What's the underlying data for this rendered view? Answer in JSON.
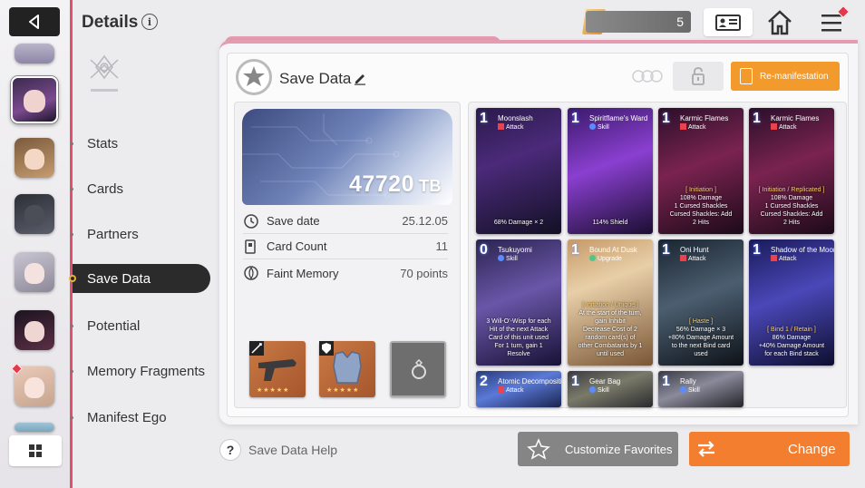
{
  "header": {
    "title": "Details",
    "currency_amount": "5"
  },
  "nav": {
    "items": [
      {
        "label": "Stats",
        "active": false
      },
      {
        "label": "Cards",
        "active": false
      },
      {
        "label": "Partners",
        "active": false
      },
      {
        "label": "Save Data",
        "active": true
      },
      {
        "label": "Potential",
        "active": false
      },
      {
        "label": "Memory Fragments",
        "active": false
      },
      {
        "label": "Manifest Ego",
        "active": false
      }
    ]
  },
  "save": {
    "title": "Save Data",
    "tb_value": "47720",
    "tb_unit": "TB",
    "remanifest_label": "Re-manifestation",
    "stats": [
      {
        "label": "Save date",
        "value": "25.12.05"
      },
      {
        "label": "Card Count",
        "value": "11"
      },
      {
        "label": "Faint Memory",
        "value": "70 points"
      }
    ]
  },
  "cards": [
    {
      "cost": "1",
      "name": "Moonslash",
      "type": "Attack",
      "desc": "68% Damage × 2",
      "tag": ""
    },
    {
      "cost": "1",
      "name": "Spiritflame's Ward",
      "type": "Skill",
      "desc": "114% Shield",
      "tag": ""
    },
    {
      "cost": "1",
      "name": "Karmic Flames",
      "type": "Attack",
      "desc": "108% Damage\n1 Cursed Shackles\nCursed Shackles: Add\n2 Hits",
      "tag": "[ Initiation ]"
    },
    {
      "cost": "1",
      "name": "Karmic Flames",
      "type": "Attack",
      "desc": "108% Damage\n1 Cursed Shackles\nCursed Shackles: Add\n2 Hits",
      "tag": "[ Initiation / Replicated ]"
    },
    {
      "cost": "0",
      "name": "Tsukuyomi",
      "type": "Skill",
      "desc": "3 Will-O'-Wisp for each\nHit of the next Attack\nCard of this unit used\nFor 1 turn, gain 1\nResolve",
      "tag": ""
    },
    {
      "cost": "1",
      "name": "Bound At Dusk",
      "type": "Upgrade",
      "desc": "At the start of the turn,\ngain Inhibit\nDecrease Cost of 2\nrandom card(s) of\nother Combatants by 1\nuntil used",
      "tag": "[ Initiation / Unique ]"
    },
    {
      "cost": "1",
      "name": "Oni Hunt",
      "type": "Attack",
      "desc": "56% Damage × 3\n+80% Damage Amount\nto the next Bind card\nused",
      "tag": "[ Haste ]"
    },
    {
      "cost": "1",
      "name": "Shadow of the Moon",
      "type": "Attack",
      "desc": "86% Damage\n+40% Damage Amount\nfor each Bind stack",
      "tag": "[ Bind 1 / Retain ]"
    },
    {
      "cost": "2",
      "name": "Atomic Decomposition",
      "type": "Attack",
      "desc": "",
      "tag": ""
    },
    {
      "cost": "1",
      "name": "Gear Bag",
      "type": "Skill",
      "desc": "",
      "tag": ""
    },
    {
      "cost": "1",
      "name": "Rally",
      "type": "Skill",
      "desc": "",
      "tag": ""
    }
  ],
  "footer": {
    "help_label": "Save Data Help",
    "favorites_label": "Customize Favorites",
    "change_label": "Change"
  },
  "colors": {
    "accent_pink": "#e2506d",
    "orange": "#f47e2f",
    "attack_red": "#e8434f",
    "skill_blue": "#5b8cff",
    "upgrade_green": "#4fc78a"
  },
  "icons": [
    "back-icon",
    "info-icon",
    "grid-icon",
    "profile-card-icon",
    "home-icon",
    "menu-icon",
    "edit-icon",
    "lock-icon",
    "calendar-clock-icon",
    "card-icon",
    "memory-icon",
    "help-icon",
    "star-icon",
    "swap-icon"
  ]
}
